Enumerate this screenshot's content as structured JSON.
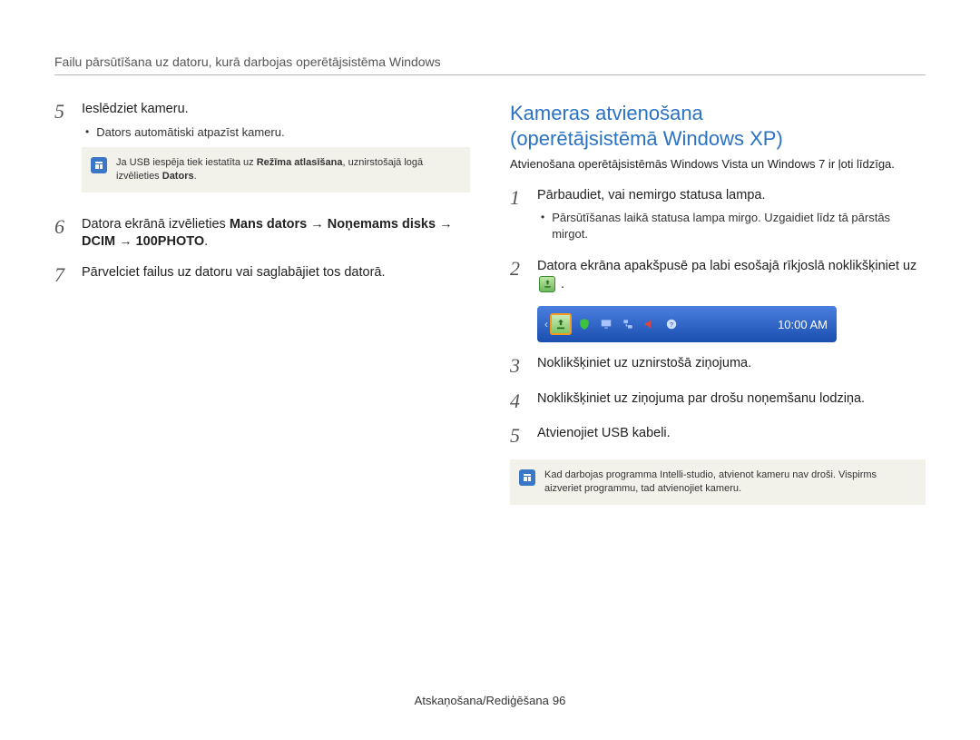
{
  "header": {
    "breadcrumb": "Failu pārsūtīšana uz datoru, kurā darbojas operētājsistēma Windows"
  },
  "left": {
    "step5": {
      "num": "5",
      "text": "Ieslēdziet kameru.",
      "bullet1": "Dators automātiski atpazīst kameru."
    },
    "note": {
      "prefix": "Ja USB iespēja tiek iestatīta uz ",
      "bold1": "Režīma atlasīšana",
      "mid": ", uznirstošajā logā izvēlieties ",
      "bold2": "Dators",
      "suffix": "."
    },
    "step6": {
      "num": "6",
      "prefix": "Datora ekrānā izvēlieties ",
      "bold": "Mans dators → Noņemams disks → DCIM → 100PHOTO",
      "suffix": "."
    },
    "step7": {
      "num": "7",
      "text": "Pārvelciet failus uz datoru vai saglabājiet tos datorā."
    }
  },
  "right": {
    "title_line1": "Kameras atvienošana",
    "title_line2": "(operētājsistēmā Windows XP)",
    "intro": "Atvienošana operētājsistēmās Windows Vista un Windows 7 ir ļoti līdzīga.",
    "step1": {
      "num": "1",
      "text": "Pārbaudiet, vai nemirgo statusa lampa.",
      "bullet1": "Pārsūtīšanas laikā statusa lampa mirgo. Uzgaidiet līdz tā pārstās mirgot."
    },
    "step2": {
      "num": "2",
      "prefix": "Datora ekrāna apakšpusē pa labi esošajā rīkjoslā noklikšķiniet uz ",
      "suffix": "."
    },
    "taskbar": {
      "clock": "10:00 AM"
    },
    "step3": {
      "num": "3",
      "text": "Noklikšķiniet uz uznirstošā ziņojuma."
    },
    "step4": {
      "num": "4",
      "text": "Noklikšķiniet uz ziņojuma par drošu noņemšanu lodziņa."
    },
    "step5": {
      "num": "5",
      "text": "Atvienojiet USB kabeli."
    },
    "note": {
      "text": "Kad darbojas programma Intelli-studio, atvienot kameru nav droši. Vispirms aizveriet programmu, tad atvienojiet kameru."
    }
  },
  "footer": {
    "section": "Atskaņošana/Rediģēšana",
    "page": "96"
  }
}
